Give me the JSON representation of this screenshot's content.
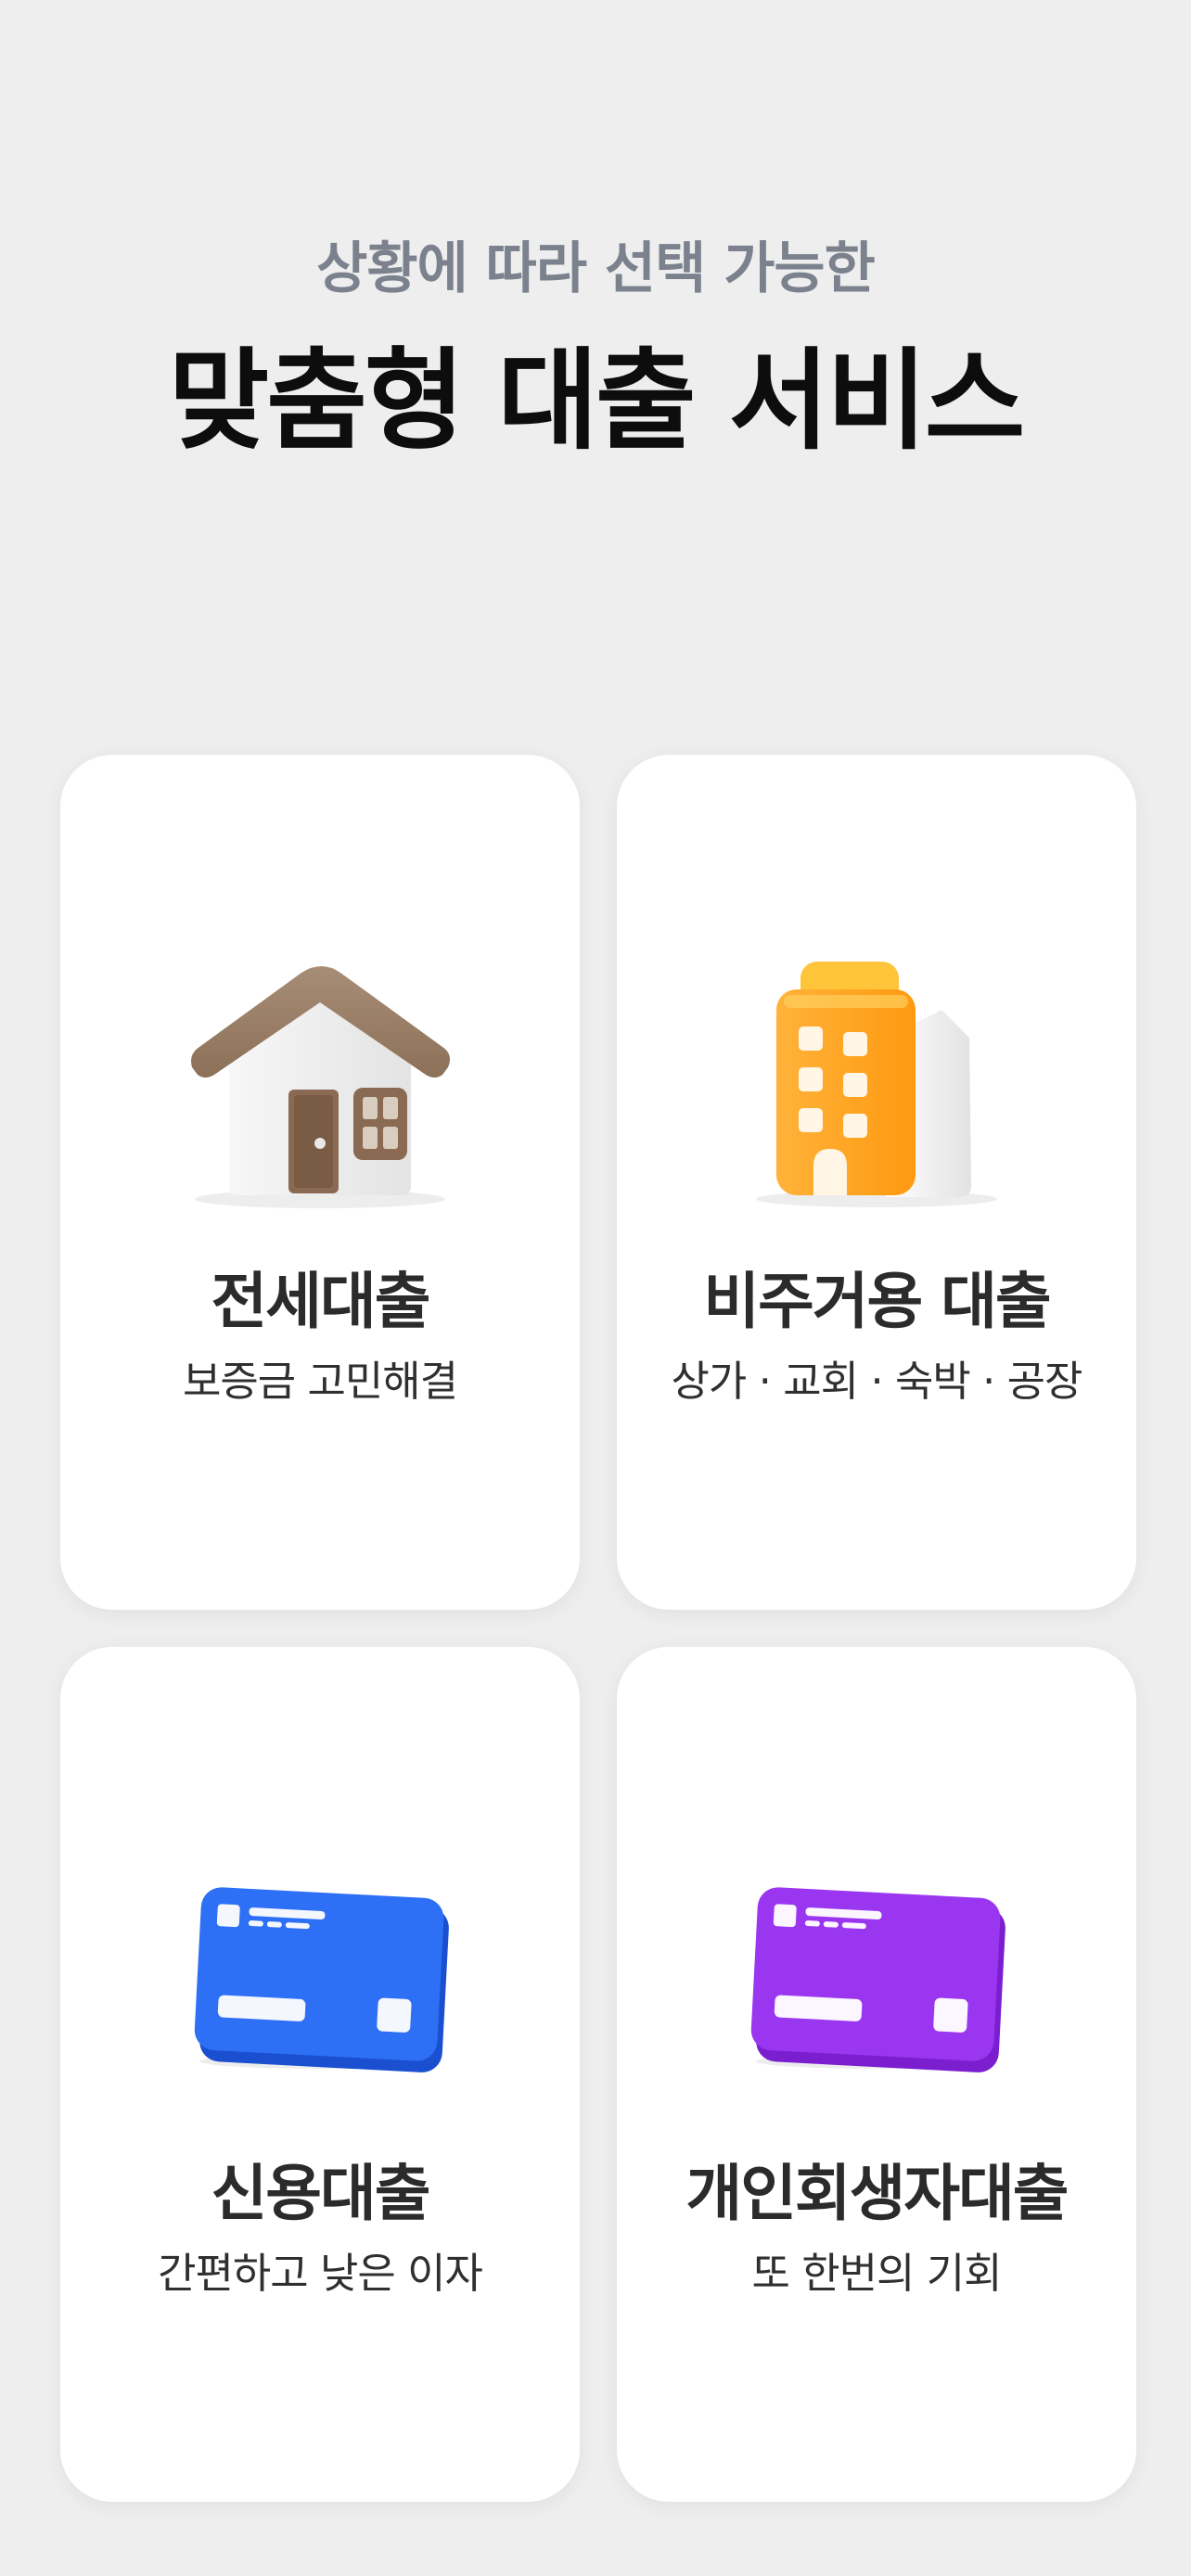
{
  "header": {
    "subtitle": "상황에 따라 선택 가능한",
    "title": "맞춤형 대출 서비스"
  },
  "cards": [
    {
      "title": "전세대출",
      "desc": "보증금 고민해결",
      "icon": "house-icon"
    },
    {
      "title": "비주거용 대출",
      "desc": "상가 · 교회 · 숙박 · 공장",
      "icon": "building-icon"
    },
    {
      "title": "신용대출",
      "desc": "간편하고 낮은 이자",
      "icon": "credit-card-icon",
      "color": "#2d6ff5"
    },
    {
      "title": "개인회생자대출",
      "desc": "또 한번의 기회",
      "icon": "credit-card-icon",
      "color": "#9b36f0"
    }
  ],
  "colors": {
    "background": "#eeeeee",
    "card": "#ffffff",
    "subtitle": "#7b828d",
    "title": "#0d0d0d",
    "house_roof": "#9c8068",
    "building": "#ffa319",
    "card_blue": "#2d6ff5",
    "card_purple": "#9b36f0"
  }
}
